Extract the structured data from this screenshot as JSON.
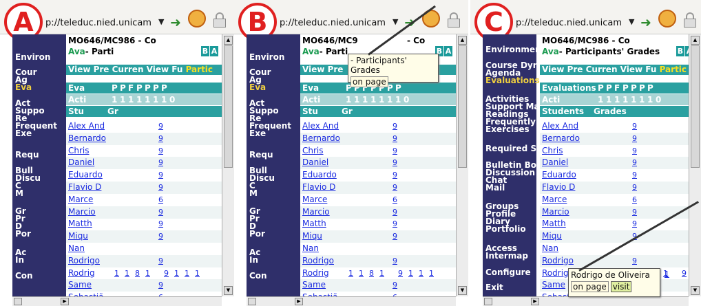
{
  "address_url": "p://teleduc.nied.unicam",
  "panels": [
    {
      "label": "A",
      "title": "MO646/MC986 - Co",
      "subtitle_green": "Ava",
      "subtitle_rest": "- Parti",
      "sidebar": [
        "Environ",
        "Cour",
        "Ag",
        "Eva",
        "Act",
        "Suppo",
        "Re",
        "Frequent",
        "Exe",
        "Requ",
        "Bull",
        "Discu",
        "C",
        "M",
        "Gr",
        "Pr",
        "D",
        "Por",
        "Ac",
        "In",
        "Con"
      ],
      "active_index": 3,
      "tabs": "View Pre Curren View Fu ",
      "tabs_hi": "Partic",
      "h1": "Eva",
      "h2": "Acti",
      "h3a": "Stu",
      "h3b": "Gr",
      "students": [
        "Alex And",
        "Bernardo",
        "Chris",
        "Daniel",
        "Eduardo",
        "Flavio D",
        "Marce",
        "Marcio",
        "Matth",
        "Miqu",
        "Nan",
        "Rodrigo",
        "Rodrig",
        "Same",
        "Sebastiã"
      ]
    },
    {
      "label": "B",
      "title": "MO646/MC9",
      "title2": "- Co",
      "subtitle_green": "Ava",
      "subtitle_rest": "- Parti",
      "sidebar": [
        "Environ",
        "Cour",
        "Ag",
        "Eva",
        "Act",
        "Suppo",
        "Re",
        "Frequent",
        "Exe",
        "Requ",
        "Bull",
        "Discu",
        "C",
        "M",
        "Gr",
        "Pr",
        "D",
        "Por",
        "Ac",
        "In",
        "Con"
      ],
      "active_index": 3,
      "tabs": "View Pre",
      "tabs_hi": "",
      "h1": "Eva",
      "h2": "Acti",
      "h3a": "Stu",
      "h3b": "Gr",
      "students": [
        "Alex And",
        "Bernardo",
        "Chris",
        "Daniel",
        "Eduardo",
        "Flavio D",
        "Marce",
        "Marcio",
        "Matth",
        "Miqu",
        "Nan",
        "Rodrigo",
        "Rodrig",
        "Same",
        "Sebastiã"
      ],
      "tooltip_text": "- Participants' Grades",
      "tooltip_btn": "on page"
    },
    {
      "label": "C",
      "title": "MO646/MC986 - Co",
      "subtitle_green": "Ava",
      "subtitle_rest": "- Participants' Grades",
      "sidebar": [
        "Environmen",
        "Course Dyn",
        "Agenda",
        "Evaluations",
        "Activities",
        "Support Ma",
        "Readings",
        "Frequently",
        "Exercises",
        "Required S",
        "Bulletin Bo",
        "Discussion",
        "Chat",
        "Mail",
        "Groups",
        "Profile",
        "Diary",
        "Portfolio",
        "Access",
        "Intermap",
        "Configure",
        "Exit"
      ],
      "active_index": 3,
      "tabs": "View Pre Curren View Fu ",
      "tabs_hi": "Partic",
      "h1": "Evaluations",
      "h2": "Acti",
      "h3a": "Students",
      "h3b": "Grades",
      "students": [
        "Alex And",
        "Bernardo",
        "Chris",
        "Daniel",
        "Eduardo",
        "Flavio D",
        "Marce",
        "Marcio",
        "Matth",
        "Miqu",
        "Nan",
        "Rodrigo",
        "Rodrig",
        "Same",
        "Sebasti"
      ],
      "tooltip_text": "Rodrigo de Oliveira",
      "tooltip_btn": "on page",
      "tooltip_btn2": "visit"
    }
  ],
  "b_tag": "BA",
  "eval_cols": [
    "P",
    "P",
    "F",
    "P",
    "P",
    "P",
    "P"
  ],
  "act_vals": [
    "1",
    "1",
    "1",
    "1",
    "1",
    "1",
    "1",
    "0"
  ],
  "grades": [
    "9",
    "9",
    "9",
    "9",
    "9",
    "9",
    "6",
    "9",
    "9",
    "9",
    "",
    "9",
    "9",
    "9",
    "6"
  ],
  "rodrig_row": [
    "1",
    "1",
    "8",
    "1",
    "9",
    "1",
    "1",
    "1"
  ],
  "c_extra": "1"
}
